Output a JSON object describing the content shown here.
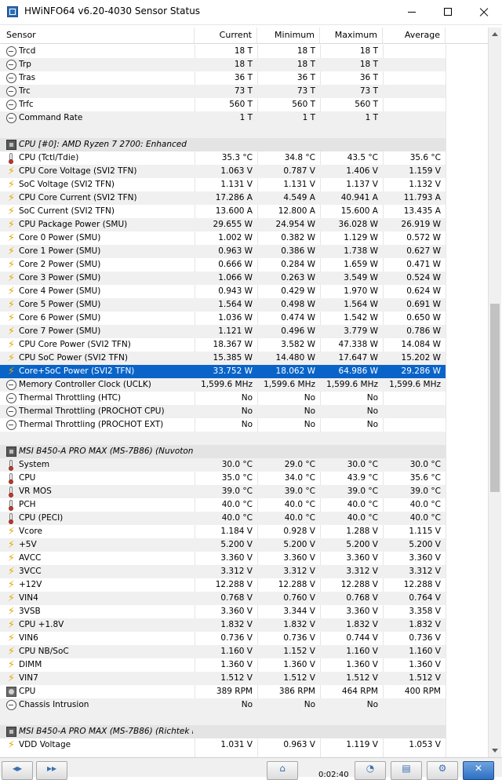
{
  "window": {
    "title": "HWiNFO64 v6.20-4030 Sensor Status"
  },
  "columns": {
    "sensor": "Sensor",
    "current": "Current",
    "minimum": "Minimum",
    "maximum": "Maximum",
    "average": "Average"
  },
  "rows": [
    {
      "kind": "sensor",
      "icon": "clock-icon",
      "name": "Trcd",
      "current": "18 T",
      "minimum": "18 T",
      "maximum": "18 T",
      "average": ""
    },
    {
      "kind": "sensor",
      "icon": "clock-icon",
      "name": "Trp",
      "current": "18 T",
      "minimum": "18 T",
      "maximum": "18 T",
      "average": ""
    },
    {
      "kind": "sensor",
      "icon": "clock-icon",
      "name": "Tras",
      "current": "36 T",
      "minimum": "36 T",
      "maximum": "36 T",
      "average": ""
    },
    {
      "kind": "sensor",
      "icon": "clock-icon",
      "name": "Trc",
      "current": "73 T",
      "minimum": "73 T",
      "maximum": "73 T",
      "average": ""
    },
    {
      "kind": "sensor",
      "icon": "clock-icon",
      "name": "Trfc",
      "current": "560 T",
      "minimum": "560 T",
      "maximum": "560 T",
      "average": ""
    },
    {
      "kind": "sensor",
      "icon": "clock-icon",
      "name": "Command Rate",
      "current": "1 T",
      "minimum": "1 T",
      "maximum": "1 T",
      "average": ""
    },
    {
      "kind": "blank"
    },
    {
      "kind": "group",
      "icon": "chip-icon",
      "name": "CPU [#0]: AMD Ryzen 7 2700: Enhanced"
    },
    {
      "kind": "sensor",
      "icon": "thermometer-icon",
      "name": "CPU (Tctl/Tdie)",
      "current": "35.3 °C",
      "minimum": "34.8 °C",
      "maximum": "43.5 °C",
      "average": "35.6 °C"
    },
    {
      "kind": "sensor",
      "icon": "bolt-icon",
      "name": "CPU Core Voltage (SVI2 TFN)",
      "current": "1.063 V",
      "minimum": "0.787 V",
      "maximum": "1.406 V",
      "average": "1.159 V"
    },
    {
      "kind": "sensor",
      "icon": "bolt-icon",
      "name": "SoC Voltage (SVI2 TFN)",
      "current": "1.131 V",
      "minimum": "1.131 V",
      "maximum": "1.137 V",
      "average": "1.132 V"
    },
    {
      "kind": "sensor",
      "icon": "bolt-icon",
      "name": "CPU Core Current (SVI2 TFN)",
      "current": "17.286 A",
      "minimum": "4.549 A",
      "maximum": "40.941 A",
      "average": "11.793 A"
    },
    {
      "kind": "sensor",
      "icon": "bolt-icon",
      "name": "SoC Current (SVI2 TFN)",
      "current": "13.600 A",
      "minimum": "12.800 A",
      "maximum": "15.600 A",
      "average": "13.435 A"
    },
    {
      "kind": "sensor",
      "icon": "bolt-icon",
      "name": "CPU Package Power (SMU)",
      "current": "29.655 W",
      "minimum": "24.954 W",
      "maximum": "36.028 W",
      "average": "26.919 W"
    },
    {
      "kind": "sensor",
      "icon": "bolt-icon",
      "name": "Core 0 Power (SMU)",
      "current": "1.002 W",
      "minimum": "0.382 W",
      "maximum": "1.129 W",
      "average": "0.572 W"
    },
    {
      "kind": "sensor",
      "icon": "bolt-icon",
      "name": "Core 1 Power (SMU)",
      "current": "0.963 W",
      "minimum": "0.386 W",
      "maximum": "1.738 W",
      "average": "0.627 W"
    },
    {
      "kind": "sensor",
      "icon": "bolt-icon",
      "name": "Core 2 Power (SMU)",
      "current": "0.666 W",
      "minimum": "0.284 W",
      "maximum": "1.659 W",
      "average": "0.471 W"
    },
    {
      "kind": "sensor",
      "icon": "bolt-icon",
      "name": "Core 3 Power (SMU)",
      "current": "1.066 W",
      "minimum": "0.263 W",
      "maximum": "3.549 W",
      "average": "0.524 W"
    },
    {
      "kind": "sensor",
      "icon": "bolt-icon",
      "name": "Core 4 Power (SMU)",
      "current": "0.943 W",
      "minimum": "0.429 W",
      "maximum": "1.970 W",
      "average": "0.624 W"
    },
    {
      "kind": "sensor",
      "icon": "bolt-icon",
      "name": "Core 5 Power (SMU)",
      "current": "1.564 W",
      "minimum": "0.498 W",
      "maximum": "1.564 W",
      "average": "0.691 W"
    },
    {
      "kind": "sensor",
      "icon": "bolt-icon",
      "name": "Core 6 Power (SMU)",
      "current": "1.036 W",
      "minimum": "0.474 W",
      "maximum": "1.542 W",
      "average": "0.650 W"
    },
    {
      "kind": "sensor",
      "icon": "bolt-icon",
      "name": "Core 7 Power (SMU)",
      "current": "1.121 W",
      "minimum": "0.496 W",
      "maximum": "3.779 W",
      "average": "0.786 W"
    },
    {
      "kind": "sensor",
      "icon": "bolt-icon",
      "name": "CPU Core Power (SVI2 TFN)",
      "current": "18.367 W",
      "minimum": "3.582 W",
      "maximum": "47.338 W",
      "average": "14.084 W"
    },
    {
      "kind": "sensor",
      "icon": "bolt-icon",
      "name": "CPU SoC Power (SVI2 TFN)",
      "current": "15.385 W",
      "minimum": "14.480 W",
      "maximum": "17.647 W",
      "average": "15.202 W"
    },
    {
      "kind": "sensor",
      "icon": "bolt-icon",
      "name": "Core+SoC Power (SVI2 TFN)",
      "current": "33.752 W",
      "minimum": "18.062 W",
      "maximum": "64.986 W",
      "average": "29.286 W",
      "selected": true
    },
    {
      "kind": "sensor",
      "icon": "clock-icon",
      "name": "Memory Controller Clock (UCLK)",
      "current": "1,599.6 MHz",
      "minimum": "1,599.6 MHz",
      "maximum": "1,599.6 MHz",
      "average": "1,599.6 MHz"
    },
    {
      "kind": "sensor",
      "icon": "clock-icon",
      "name": "Thermal Throttling (HTC)",
      "current": "No",
      "minimum": "No",
      "maximum": "No",
      "average": ""
    },
    {
      "kind": "sensor",
      "icon": "clock-icon",
      "name": "Thermal Throttling (PROCHOT CPU)",
      "current": "No",
      "minimum": "No",
      "maximum": "No",
      "average": ""
    },
    {
      "kind": "sensor",
      "icon": "clock-icon",
      "name": "Thermal Throttling (PROCHOT EXT)",
      "current": "No",
      "minimum": "No",
      "maximum": "No",
      "average": ""
    },
    {
      "kind": "blank"
    },
    {
      "kind": "group",
      "icon": "chip-icon",
      "name": "MSI B450-A PRO MAX (MS-7B86) (Nuvoton ..."
    },
    {
      "kind": "sensor",
      "icon": "thermometer-icon",
      "name": "System",
      "current": "30.0 °C",
      "minimum": "29.0 °C",
      "maximum": "30.0 °C",
      "average": "30.0 °C"
    },
    {
      "kind": "sensor",
      "icon": "thermometer-icon",
      "name": "CPU",
      "current": "35.0 °C",
      "minimum": "34.0 °C",
      "maximum": "43.9 °C",
      "average": "35.6 °C"
    },
    {
      "kind": "sensor",
      "icon": "thermometer-icon",
      "name": "VR MOS",
      "current": "39.0 °C",
      "minimum": "39.0 °C",
      "maximum": "39.0 °C",
      "average": "39.0 °C"
    },
    {
      "kind": "sensor",
      "icon": "thermometer-icon",
      "name": "PCH",
      "current": "40.0 °C",
      "minimum": "40.0 °C",
      "maximum": "40.0 °C",
      "average": "40.0 °C"
    },
    {
      "kind": "sensor",
      "icon": "thermometer-icon",
      "name": "CPU (PECI)",
      "current": "40.0 °C",
      "minimum": "40.0 °C",
      "maximum": "40.0 °C",
      "average": "40.0 °C"
    },
    {
      "kind": "sensor",
      "icon": "bolt-icon",
      "name": "Vcore",
      "current": "1.184 V",
      "minimum": "0.928 V",
      "maximum": "1.288 V",
      "average": "1.115 V"
    },
    {
      "kind": "sensor",
      "icon": "bolt-icon",
      "name": "+5V",
      "current": "5.200 V",
      "minimum": "5.200 V",
      "maximum": "5.200 V",
      "average": "5.200 V"
    },
    {
      "kind": "sensor",
      "icon": "bolt-icon",
      "name": "AVCC",
      "current": "3.360 V",
      "minimum": "3.360 V",
      "maximum": "3.360 V",
      "average": "3.360 V"
    },
    {
      "kind": "sensor",
      "icon": "bolt-icon",
      "name": "3VCC",
      "current": "3.312 V",
      "minimum": "3.312 V",
      "maximum": "3.312 V",
      "average": "3.312 V"
    },
    {
      "kind": "sensor",
      "icon": "bolt-icon",
      "name": "+12V",
      "current": "12.288 V",
      "minimum": "12.288 V",
      "maximum": "12.288 V",
      "average": "12.288 V"
    },
    {
      "kind": "sensor",
      "icon": "bolt-icon",
      "name": "VIN4",
      "current": "0.768 V",
      "minimum": "0.760 V",
      "maximum": "0.768 V",
      "average": "0.764 V"
    },
    {
      "kind": "sensor",
      "icon": "bolt-icon",
      "name": "3VSB",
      "current": "3.360 V",
      "minimum": "3.344 V",
      "maximum": "3.360 V",
      "average": "3.358 V"
    },
    {
      "kind": "sensor",
      "icon": "bolt-icon",
      "name": "CPU +1.8V",
      "current": "1.832 V",
      "minimum": "1.832 V",
      "maximum": "1.832 V",
      "average": "1.832 V"
    },
    {
      "kind": "sensor",
      "icon": "bolt-icon",
      "name": "VIN6",
      "current": "0.736 V",
      "minimum": "0.736 V",
      "maximum": "0.744 V",
      "average": "0.736 V"
    },
    {
      "kind": "sensor",
      "icon": "bolt-icon",
      "name": "CPU NB/SoC",
      "current": "1.160 V",
      "minimum": "1.152 V",
      "maximum": "1.160 V",
      "average": "1.160 V"
    },
    {
      "kind": "sensor",
      "icon": "bolt-icon",
      "name": "DIMM",
      "current": "1.360 V",
      "minimum": "1.360 V",
      "maximum": "1.360 V",
      "average": "1.360 V"
    },
    {
      "kind": "sensor",
      "icon": "bolt-icon",
      "name": "VIN7",
      "current": "1.512 V",
      "minimum": "1.512 V",
      "maximum": "1.512 V",
      "average": "1.512 V"
    },
    {
      "kind": "sensor",
      "icon": "fan-icon",
      "name": "CPU",
      "current": "389 RPM",
      "minimum": "386 RPM",
      "maximum": "464 RPM",
      "average": "400 RPM"
    },
    {
      "kind": "sensor",
      "icon": "clock-icon",
      "name": "Chassis Intrusion",
      "current": "No",
      "minimum": "No",
      "maximum": "No",
      "average": ""
    },
    {
      "kind": "blank"
    },
    {
      "kind": "group",
      "icon": "chip-icon",
      "name": "MSI B450-A PRO MAX (MS-7B86) (Richtek R..."
    },
    {
      "kind": "sensor",
      "icon": "bolt-icon",
      "name": "VDD Voltage",
      "current": "1.031 V",
      "minimum": "0.963 V",
      "maximum": "1.119 V",
      "average": "1.053 V"
    }
  ],
  "toolbar": {
    "elapsed": "0:02:40"
  },
  "colors": {
    "selection": "#0a64c8",
    "stripe": "#f0f0f0",
    "group_band": "#e4e4e4",
    "bolt": "#e6a800"
  }
}
